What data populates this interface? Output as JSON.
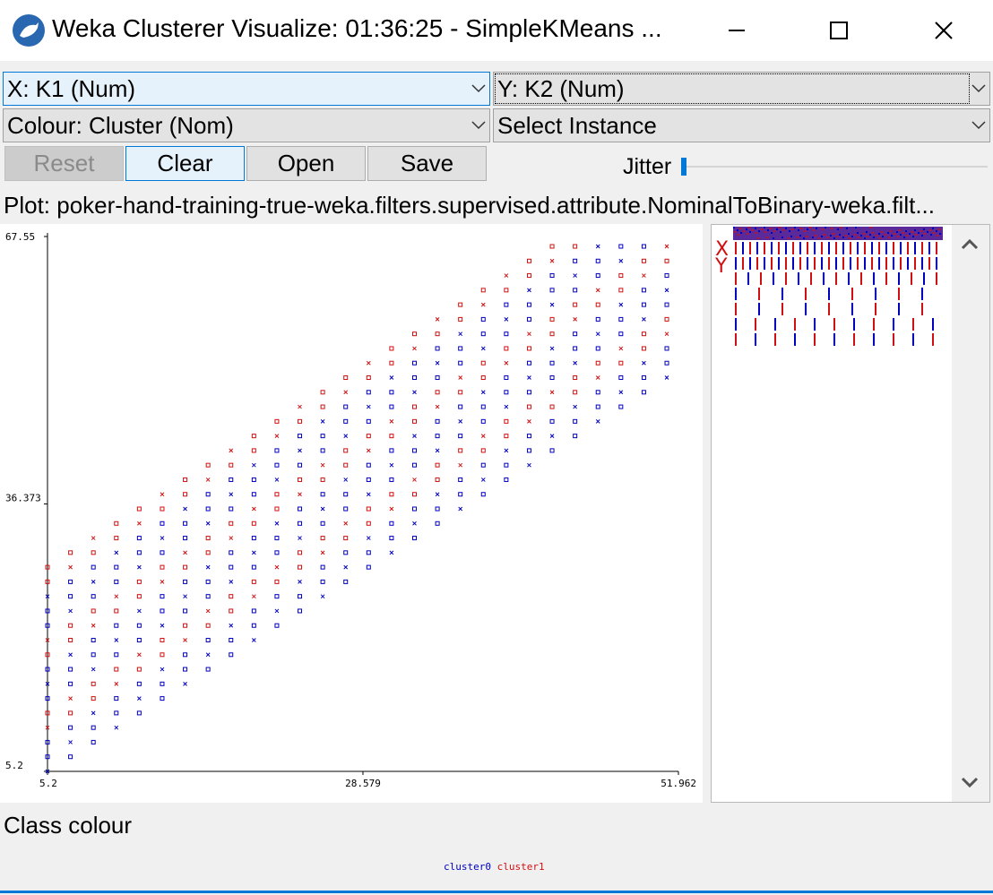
{
  "window": {
    "title": "Weka Clusterer Visualize: 01:36:25 - SimpleKMeans ...",
    "minimize_icon": "minimize-icon",
    "maximize_icon": "maximize-icon",
    "close_icon": "close-icon"
  },
  "controls": {
    "x_axis": "X: K1 (Num)",
    "y_axis": "Y: K2 (Num)",
    "colour": "Colour: Cluster (Nom)",
    "select_instance": "Select Instance",
    "reset_label": "Reset",
    "clear_label": "Clear",
    "open_label": "Open",
    "save_label": "Save",
    "jitter_label": "Jitter",
    "jitter_value": 0
  },
  "plot": {
    "title": "Plot: poker-hand-training-true-weka.filters.supervised.attribute.NominalToBinary-weka.filt..."
  },
  "chart_data": {
    "type": "scatter",
    "title": "",
    "xlabel": "",
    "ylabel": "",
    "xlim": [
      5.2,
      51.962
    ],
    "ylim": [
      5.2,
      67.55
    ],
    "xticks": [
      "5.2",
      "28.579",
      "51.962"
    ],
    "yticks": [
      "5.2",
      "36.373",
      "67.55"
    ],
    "grid": false,
    "series": [
      {
        "name": "cluster0",
        "color": "#0000c0"
      },
      {
        "name": "cluster1",
        "color": "#d01010"
      }
    ],
    "x": [
      5.2,
      6.9,
      8.6,
      10.3,
      12.0,
      13.7,
      15.4,
      17.1,
      18.8,
      20.5,
      22.2,
      23.9,
      25.6,
      27.3,
      29.0,
      30.7,
      32.4,
      34.1,
      35.8,
      37.5,
      39.2,
      40.9,
      42.6,
      44.3,
      46.0,
      47.7,
      49.4,
      51.1
    ],
    "band_lower_offset": -1.0,
    "band_upper_offset": 25.0,
    "note_series_assignment": "alternating blue/red markers throughout the diagonal band"
  },
  "side_panel": {
    "attribute_strip_count": 8,
    "selected_x_marker": "X",
    "selected_y_marker": "Y"
  },
  "legend": {
    "title": "Class colour",
    "items": [
      {
        "label": "cluster0",
        "color": "#0000c0"
      },
      {
        "label": "cluster1",
        "color": "#d01010"
      }
    ]
  }
}
